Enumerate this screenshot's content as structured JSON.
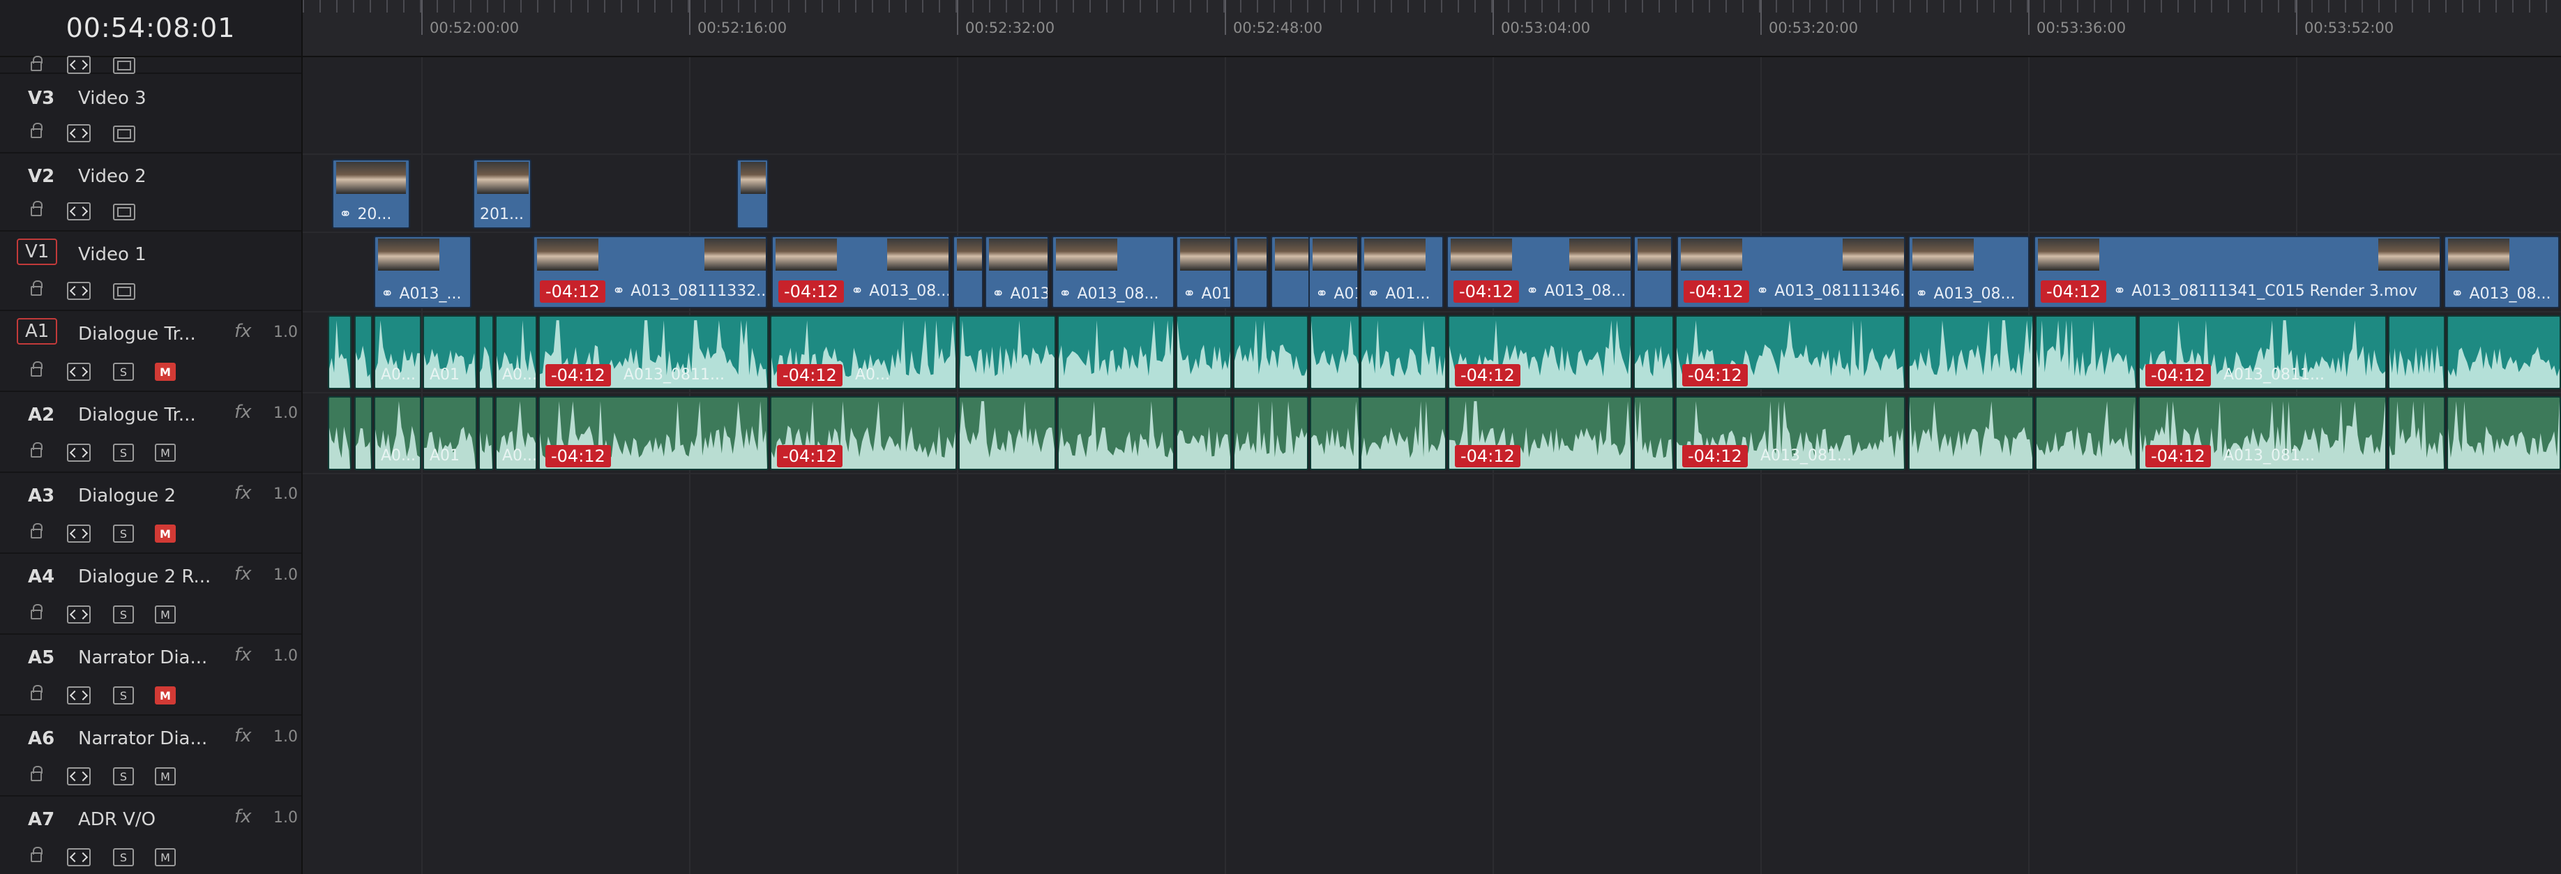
{
  "timecode": "00:54:08:01",
  "ruler_labels": [
    "00:52:00:00",
    "00:52:16:00",
    "00:52:32:00",
    "00:52:48:00",
    "00:53:04:00",
    "00:53:20:00",
    "00:53:36:00",
    "00:53:52:00"
  ],
  "video_tracks": [
    {
      "id": "V3",
      "name": "Video 3"
    },
    {
      "id": "V2",
      "name": "Video 2"
    },
    {
      "id": "V1",
      "name": "Video 1"
    }
  ],
  "audio_tracks": [
    {
      "id": "A1",
      "name": "Dialogue  Tr...",
      "fx": "fx",
      "vol": "1.0",
      "solo": "S",
      "mute": "M"
    },
    {
      "id": "A2",
      "name": "Dialogue  Tr...",
      "fx": "fx",
      "vol": "1.0",
      "solo": "S",
      "mute": "M"
    },
    {
      "id": "A3",
      "name": "Dialogue 2",
      "fx": "fx",
      "vol": "1.0",
      "solo": "S",
      "mute": "M"
    },
    {
      "id": "A4",
      "name": "Dialogue 2 R...",
      "fx": "fx",
      "vol": "1.0",
      "solo": "S",
      "mute": "M"
    },
    {
      "id": "A5",
      "name": "Narrator Dia...",
      "fx": "fx",
      "vol": "1.0",
      "solo": "S",
      "mute": "M"
    },
    {
      "id": "A6",
      "name": "Narrator Dia...",
      "fx": "fx",
      "vol": "1.0",
      "solo": "S",
      "mute": "M"
    },
    {
      "id": "A7",
      "name": "ADR V/O",
      "fx": "fx",
      "vol": "1.0",
      "solo": "S",
      "mute": "M"
    }
  ],
  "v2_clips": [
    {
      "label": "20..."
    },
    {
      "label": "201..."
    },
    {
      "label": ""
    }
  ],
  "v1_clips": [
    {
      "label": "A013_...",
      "offset": ""
    },
    {
      "label": "A013_08111332...",
      "offset": "-04:12"
    },
    {
      "label": "A013_08...",
      "offset": "-04:12"
    },
    {
      "label": "A013...",
      "offset": ""
    },
    {
      "label": "A013_08...",
      "offset": ""
    },
    {
      "label": "A01...",
      "offset": ""
    },
    {
      "label": "A01...",
      "offset": ""
    },
    {
      "label": "A01...",
      "offset": ""
    },
    {
      "label": "A013_08...",
      "offset": "-04:12"
    },
    {
      "label": "A013_08111346...",
      "offset": "-04:12"
    },
    {
      "label": "A013_08...",
      "offset": ""
    },
    {
      "label": "A013_08111341_C015 Render 3.mov",
      "offset": "-04:12"
    },
    {
      "label": "A013_08...",
      "offset": ""
    }
  ],
  "a1_clips": [
    {
      "label": "A0...",
      "offset": ""
    },
    {
      "label": "A01",
      "offset": ""
    },
    {
      "label": "A0...",
      "offset": ""
    },
    {
      "label": "A013_0811...",
      "offset": "-04:12"
    },
    {
      "label": "A0...",
      "offset": "-04:12"
    },
    {
      "label": "",
      "offset": "-04:12"
    },
    {
      "label": "",
      "offset": "-04:12"
    },
    {
      "label": "A013_0811...",
      "offset": "-04:12"
    }
  ],
  "a2_clips": [
    {
      "label": "A0...",
      "offset": ""
    },
    {
      "label": "A01",
      "offset": ""
    },
    {
      "label": "A0...",
      "offset": ""
    },
    {
      "label": "",
      "offset": "-04:12"
    },
    {
      "label": "",
      "offset": "-04:12"
    },
    {
      "label": "",
      "offset": "-04:12"
    },
    {
      "label": "A013_081...",
      "offset": "-04:12"
    },
    {
      "label": "A013_081...",
      "offset": "-04:12"
    }
  ],
  "colors": {
    "video_clip": "#3f6a9c",
    "a1_clip": "#1e8a82",
    "a2_clip": "#3d7a5a",
    "offset_badge": "#c8222b",
    "mute_on": "#d23a35"
  },
  "mute_active_tracks": [
    "A1",
    "A3",
    "A5"
  ]
}
